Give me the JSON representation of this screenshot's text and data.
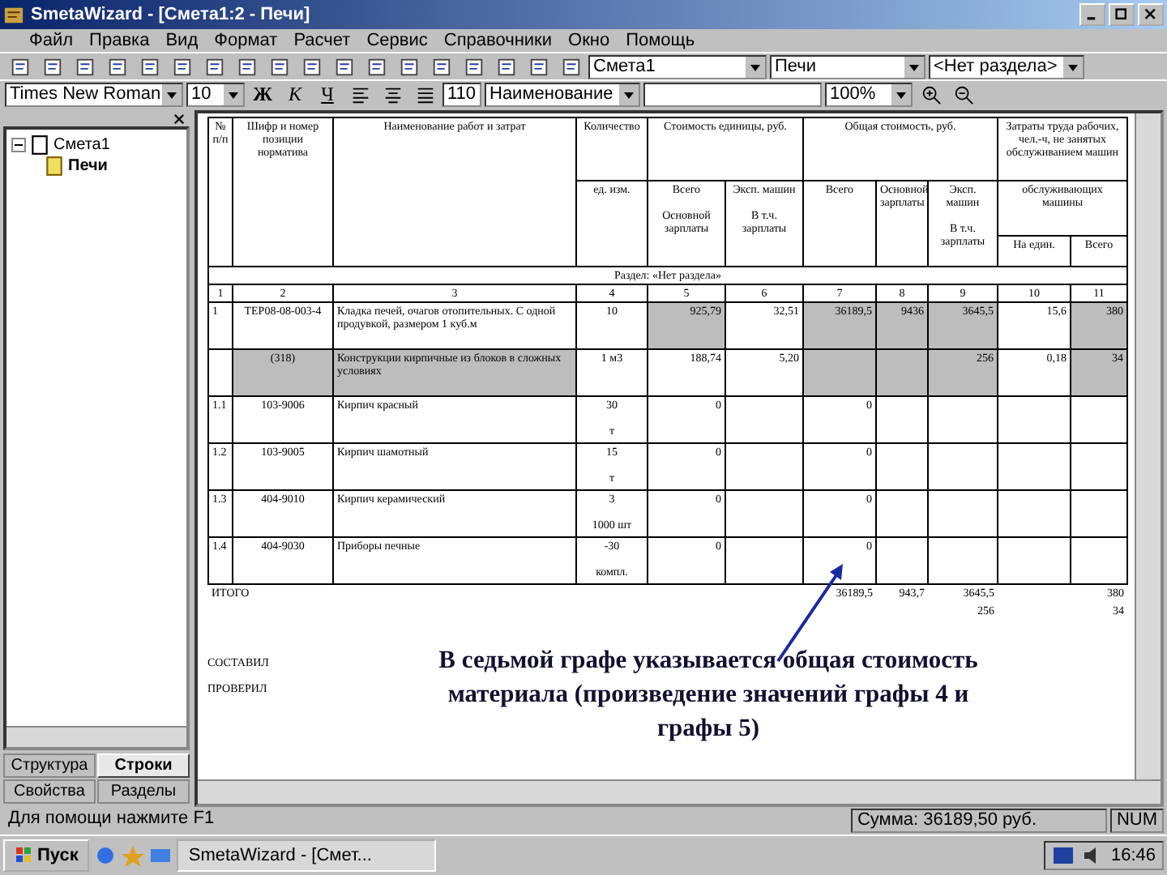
{
  "window": {
    "title": "SmetaWizard - [Смета1:2 - Печи]"
  },
  "menu": [
    "Файл",
    "Правка",
    "Вид",
    "Формат",
    "Расчет",
    "Сервис",
    "Справочники",
    "Окно",
    "Помощь"
  ],
  "toolbar": {
    "estimate": "Смета1",
    "part": "Печи",
    "section": "<Нет раздела>"
  },
  "format_bar": {
    "font": "Times New Roman",
    "size": "10",
    "bold": "Ж",
    "italic": "К",
    "underline": "Ч",
    "code": "110",
    "field": "Наименование",
    "zoom": "100%"
  },
  "tree": [
    {
      "label": "Смета1",
      "expanded": true,
      "children": [
        {
          "label": "Печи",
          "selected": true
        }
      ]
    }
  ],
  "panel_tabs": [
    {
      "label": "Структура",
      "selected": false
    },
    {
      "label": "Строки",
      "selected": true
    },
    {
      "label": "Свойства",
      "selected": false
    },
    {
      "label": "Разделы",
      "selected": false
    }
  ],
  "table": {
    "header": {
      "num": "№ п/п",
      "code": "Шифр и номер позиции норматива",
      "name": "Наименование работ и затрат",
      "qty": "Количество",
      "unit": "ед. изм.",
      "unit_cost": "Стоимость единицы, руб.",
      "total_cost": "Общая стоимость, руб.",
      "labor": "Затраты труда рабочих, чел.-ч, не занятых обслуживанием машин",
      "sub": [
        {
          "top": "Всего",
          "bottom": "Основной зарплаты"
        },
        {
          "top": "Эксп. машин",
          "bottom": "В т.ч. зарплаты"
        },
        {
          "top": "Всего"
        },
        {
          "top": "Основной зарплаты"
        },
        {
          "top": "Эксп. машин",
          "bottom": "В т.ч. зарплаты"
        }
      ],
      "labor_sub": {
        "top": "обслуживающих машины",
        "bottom": [
          "На един.",
          "Всего"
        ]
      }
    },
    "section": "Раздел: «Нет раздела»",
    "column_numbers": [
      "1",
      "2",
      "3",
      "4",
      "5",
      "6",
      "7",
      "8",
      "9",
      "10",
      "11"
    ],
    "rows": [
      {
        "kind": "work",
        "num": "1",
        "code": "ТЕР08-08-003-4",
        "name": "Кладка печей, очагов отопительных. С одной продувкой, размером 1 куб.м",
        "qty": "10",
        "values": {
          "col_5": "925,79",
          "col_6": "32,51",
          "col_7": "36189,5",
          "col_8": "9436",
          "col_9": "3645,5",
          "col_10": "15,6",
          "col_11": "380"
        }
      },
      {
        "kind": "resource",
        "code": "(318)",
        "name": "Конструкции кирпичные из блоков в сложных условиях",
        "qty": "1 м3",
        "values": {
          "col_5": "188,74",
          "col_6": "5,20",
          "col_9": "256",
          "col_10": "0,18",
          "col_11": "34"
        }
      },
      {
        "kind": "material",
        "num": "1.1",
        "code": "103-9006",
        "name": "Кирпич красный",
        "qty": "30",
        "unit": "т",
        "values": {
          "col_5": "0",
          "col_7": "0"
        }
      },
      {
        "kind": "material",
        "num": "1.2",
        "code": "103-9005",
        "name": "Кирпич шамотный",
        "qty": "15",
        "unit": "т",
        "values": {
          "col_5": "0",
          "col_7": "0"
        }
      },
      {
        "kind": "material",
        "num": "1.3",
        "code": "404-9010",
        "name": "Кирпич керамический",
        "qty": "3",
        "unit": "1000 шт",
        "values": {
          "col_5": "0",
          "col_7": "0"
        }
      },
      {
        "kind": "material",
        "num": "1.4",
        "code": "404-9030",
        "name": "Приборы печные",
        "qty": "-30",
        "unit": "компл.",
        "values": {
          "col_5": "0",
          "col_7": "0"
        }
      }
    ],
    "totals": {
      "label": "ИТОГО",
      "values": {
        "col_7": "36189,5",
        "col_8": "943,7",
        "col_9": "3645,5",
        "col_11": "380"
      },
      "values_2": {
        "col_9": "256",
        "col_11": "34"
      }
    }
  },
  "signatures": [
    "СОСТАВИЛ",
    "ПРОВЕРИЛ"
  ],
  "note": "В седьмой графе указывается общая стоимость материала (произведение значений графы 4 и графы 5)",
  "status_bar": {
    "hint": "Для помощи нажмите F1",
    "sum": "Сумма: 36189,50 руб.",
    "mode": "NUM"
  },
  "taskbar": {
    "start": "Пуск",
    "task": "SmetaWizard - [Смет...",
    "time": "16:46"
  }
}
